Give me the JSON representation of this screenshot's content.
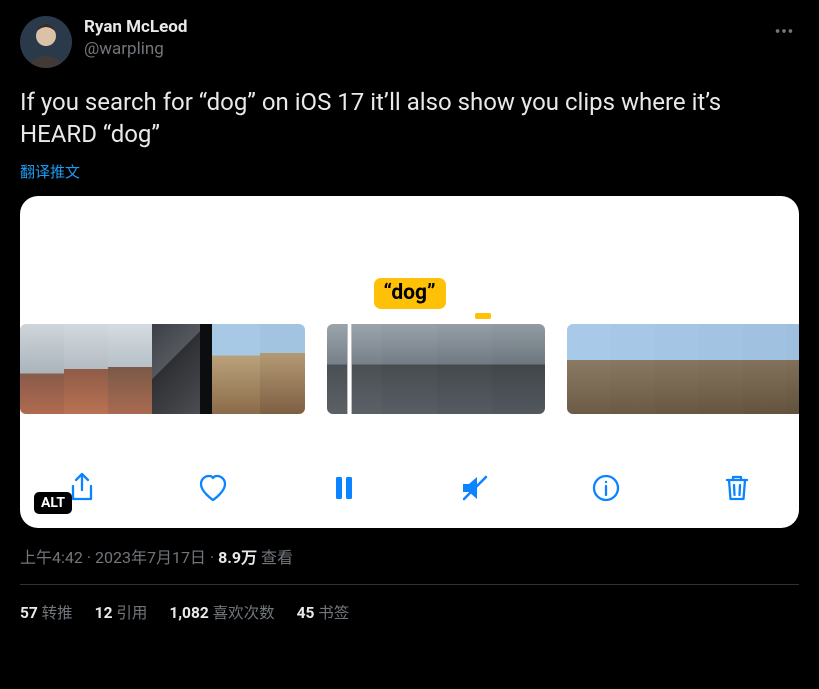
{
  "author": {
    "display_name": "Ryan McLeod",
    "handle": "@warpling"
  },
  "tweet_text": "If you search for “dog” on iOS 17 it’ll also show you clips where it’s HEARD “dog”",
  "translate_label": "翻译推文",
  "media": {
    "search_term": "“dog”",
    "alt_badge": "ALT",
    "toolbar": {
      "share": "share",
      "like": "like",
      "pause": "pause",
      "mute": "mute",
      "info": "info",
      "delete": "delete"
    }
  },
  "meta": {
    "time": "上午4:42",
    "date": "2023年7月17日",
    "views_count": "8.9万",
    "views_label": "查看",
    "sep": " · "
  },
  "stats": {
    "retweets": {
      "count": "57",
      "label": "转推"
    },
    "quotes": {
      "count": "12",
      "label": "引用"
    },
    "likes": {
      "count": "1,082",
      "label": "喜欢次数"
    },
    "bookmarks": {
      "count": "45",
      "label": "书签"
    }
  }
}
